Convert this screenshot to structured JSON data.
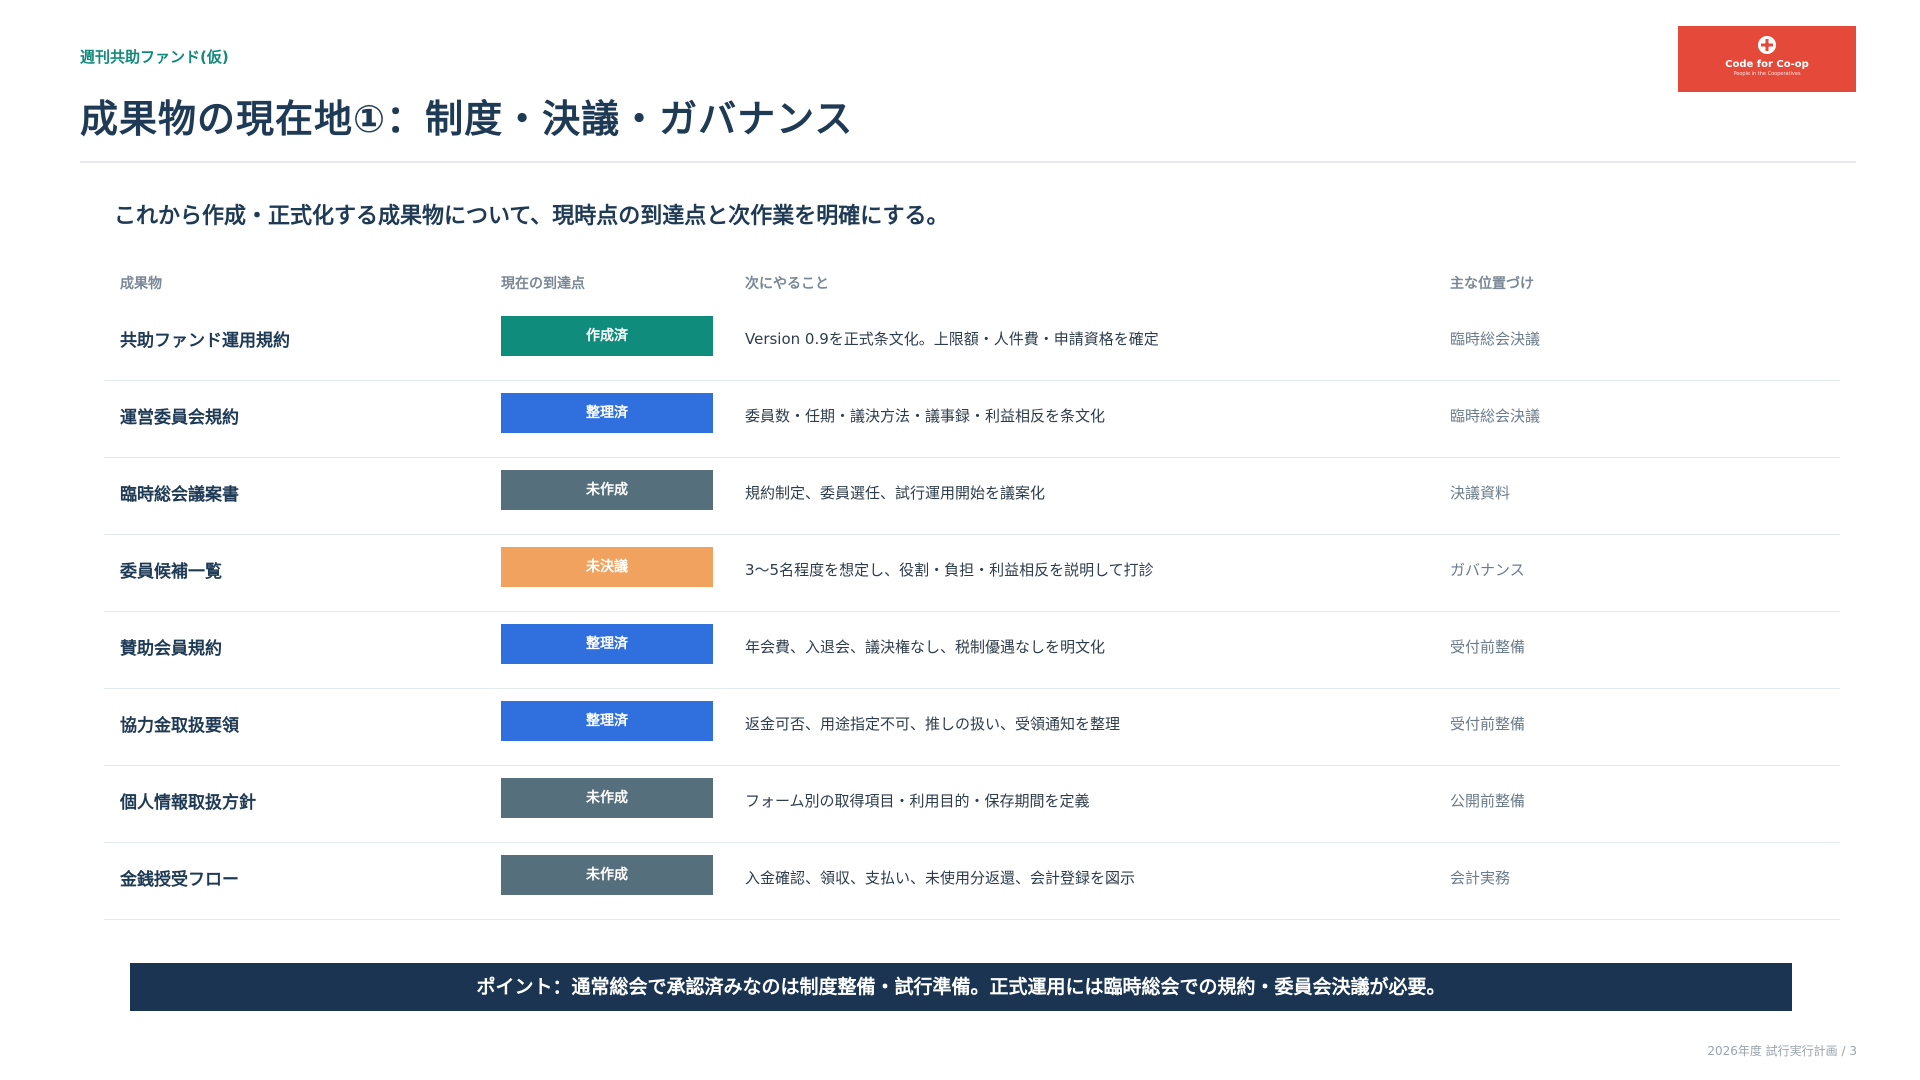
{
  "header": {
    "eyebrow": "週刊共助ファンド(仮)",
    "title": "成果物の現在地①：制度・決議・ガバナンス"
  },
  "logo": {
    "name": "Code for Co-op",
    "tagline": "People in the Cooperatives",
    "color": "#e4493a"
  },
  "lead": "これから作成・正式化する成果物について、現時点の到達点と次作業を明確にする。",
  "table": {
    "headers": {
      "name": "成果物",
      "status": "現在の到達点",
      "next": "次にやること",
      "role": "主な位置づけ"
    },
    "rows": [
      {
        "name": "共助ファンド運用規約",
        "status": "作成済",
        "status_color": "#0f8c7c",
        "next": "Version 0.9を正式条文化。上限額・人件費・申請資格を確定",
        "role": "臨時総会決議"
      },
      {
        "name": "運営委員会規約",
        "status": "整理済",
        "status_color": "#2f6fde",
        "next": "委員数・任期・議決方法・議事録・利益相反を条文化",
        "role": "臨時総会決議"
      },
      {
        "name": "臨時総会議案書",
        "status": "未作成",
        "status_color": "#566f7d",
        "next": "規約制定、委員選任、試行運用開始を議案化",
        "role": "決議資料"
      },
      {
        "name": "委員候補一覧",
        "status": "未決議",
        "status_color": "#f2a25f",
        "next": "3〜5名程度を想定し、役割・負担・利益相反を説明して打診",
        "role": "ガバナンス"
      },
      {
        "name": "賛助会員規約",
        "status": "整理済",
        "status_color": "#2f6fde",
        "next": "年会費、入退会、議決権なし、税制優遇なしを明文化",
        "role": "受付前整備"
      },
      {
        "name": "協力金取扱要領",
        "status": "整理済",
        "status_color": "#2f6fde",
        "next": "返金可否、用途指定不可、推しの扱い、受領通知を整理",
        "role": "受付前整備"
      },
      {
        "name": "個人情報取扱方針",
        "status": "未作成",
        "status_color": "#566f7d",
        "next": "フォーム別の取得項目・利用目的・保存期間を定義",
        "role": "公開前整備"
      },
      {
        "name": "金銭授受フロー",
        "status": "未作成",
        "status_color": "#566f7d",
        "next": "入金確認、領収、支払い、未使用分返還、会計登録を図示",
        "role": "会計実務"
      }
    ]
  },
  "point": "ポイント：通常総会で承認済みなのは制度整備・試行準備。正式運用には臨時総会での規約・委員会決議が必要。",
  "footer": "2026年度 試行実行計画 / 3"
}
